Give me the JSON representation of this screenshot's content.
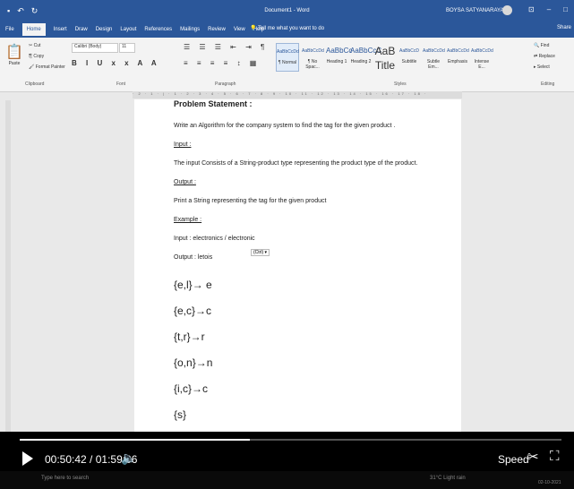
{
  "window": {
    "doc_title": "Document1 - Word",
    "user": "BOYSA SATYANARAYANA"
  },
  "menu": {
    "tabs": [
      "File",
      "Home",
      "Insert",
      "Draw",
      "Design",
      "Layout",
      "References",
      "Mailings",
      "Review",
      "View",
      "Help"
    ],
    "tellme": "Tell me what you want to do",
    "share": "Share"
  },
  "ribbon": {
    "clipboard": {
      "paste": "Paste",
      "cut": "Cut",
      "copy": "Copy",
      "format_painter": "Format Painter",
      "label": "Clipboard"
    },
    "font": {
      "name": "Calibri (Body)",
      "size": "11",
      "label": "Font"
    },
    "paragraph": {
      "label": "Paragraph"
    },
    "styles": {
      "items": [
        {
          "sample": "AaBbCcDd",
          "name": "¶ Normal"
        },
        {
          "sample": "AaBbCcDd",
          "name": "¶ No Spac..."
        },
        {
          "sample": "AaBbCc",
          "name": "Heading 1"
        },
        {
          "sample": "AaBbCcC",
          "name": "Heading 2"
        },
        {
          "sample": "AaB",
          "name": "Title"
        },
        {
          "sample": "AaBbCcD",
          "name": "Subtitle"
        },
        {
          "sample": "AaBbCcDd",
          "name": "Subtle Em..."
        },
        {
          "sample": "AaBbCcDd",
          "name": "Emphasis"
        },
        {
          "sample": "AaBbCcDd",
          "name": "Intense E..."
        }
      ],
      "label": "Styles"
    },
    "editing": {
      "find": "Find",
      "replace": "Replace",
      "select": "Select",
      "label": "Editing"
    }
  },
  "document": {
    "heading": "Problem Statement :",
    "lines": [
      {
        "text": "Write an Algorithm for the company system to find the tag for the given product .",
        "cls": ""
      },
      {
        "text": "Input :",
        "cls": "u"
      },
      {
        "text": "The input Consists of a String-product type representing the product type of the product.",
        "cls": ""
      },
      {
        "text": "Output :",
        "cls": "u"
      },
      {
        "text": "Print a String representing the tag for the given product",
        "cls": ""
      },
      {
        "text": "Example :",
        "cls": "u"
      },
      {
        "text": "Input : electronics  / electronic",
        "cls": ""
      },
      {
        "text": "Output : letois",
        "cls": ""
      }
    ],
    "mappings": [
      "{e,l}→ e",
      "{e,c}→c",
      "{t,r}→r",
      "{o,n}→n",
      "{i,c}→c",
      "{s}"
    ],
    "paste_tag": "(Ctrl) ▾"
  },
  "player": {
    "current": "00:50:42",
    "total": "01:59:06",
    "progress": 0.425,
    "speed_label": "Speed"
  },
  "taskbar": {
    "search": "Type here to search",
    "weather": "31°C Light rain",
    "date": "02-10-2021"
  }
}
